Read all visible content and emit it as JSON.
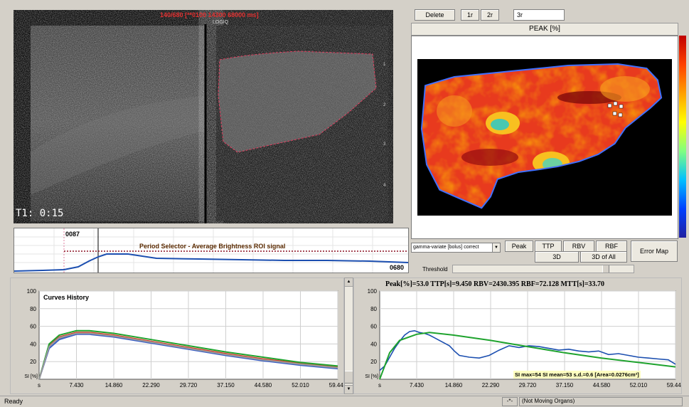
{
  "ultrasound": {
    "header_text": "140/680  [**0100 14300 68000 ms]",
    "logo_text": "LOGIQ",
    "timer": "T1: 0:15"
  },
  "toolbar": {
    "delete_label": "Delete",
    "tab_1": "1r",
    "tab_2": "2r",
    "tab_3": "3r"
  },
  "map": {
    "title": "PEAK [%]"
  },
  "period": {
    "label": "Period Selector - Average Brightness ROI signal",
    "start_frame": "0087",
    "end_frame": "0680"
  },
  "controls": {
    "model_select": "gamma-variate [bolus] correct",
    "peak": "Peak",
    "ttp": "TTP",
    "rbv": "RBV",
    "rbf": "RBF",
    "btn_3d": "3D",
    "btn_3d_all": "3D of All",
    "error_map": "Error Map",
    "threshold": "Threshold"
  },
  "history_chart": {
    "title": "Curves History",
    "ylabel": "SI [%]",
    "x_unit": "s",
    "yticks": [
      "100",
      "80",
      "60",
      "40",
      "20"
    ],
    "xticks": [
      "7.430",
      "14.860",
      "22.290",
      "29.720",
      "37.150",
      "44.580",
      "52.010",
      "59.440"
    ]
  },
  "fit_chart": {
    "header": "Peak[%]=53.0  TTP[s]=9.450  RBV=2430.395  RBF=72.128  MTT[s]=33.70",
    "stats": "SI max=54  SI mean=53   s.d.=0.6   [Area=0.0276cm²]",
    "ylabel": "SI [%]",
    "x_unit": "s",
    "yticks": [
      "100",
      "80",
      "60",
      "40",
      "20"
    ],
    "xticks": [
      "7.430",
      "14.860",
      "22.290",
      "29.720",
      "37.150",
      "44.580",
      "52.010",
      "59.440"
    ]
  },
  "status": {
    "ready": "Ready",
    "sep": "-*-",
    "mode": "(Not Moving Organs)"
  },
  "chart_data": [
    {
      "type": "line",
      "title": "Curves History",
      "xlabel": "s",
      "ylabel": "SI [%]",
      "ylim": [
        0,
        100
      ],
      "xlim": [
        0,
        59.44
      ],
      "grid": true,
      "x": [
        0,
        2,
        4,
        7.43,
        10,
        14.86,
        22.29,
        29.72,
        37.15,
        44.58,
        52.01,
        59.44
      ],
      "series": [
        {
          "color": "#d93a2b",
          "values": [
            0,
            38,
            48,
            53,
            53,
            50,
            43,
            36,
            29,
            23,
            18,
            14
          ]
        },
        {
          "color": "#f08a24",
          "values": [
            0,
            36,
            46,
            52,
            52,
            49,
            42,
            35,
            28,
            22,
            17,
            13
          ]
        },
        {
          "color": "#1fa32e",
          "values": [
            0,
            40,
            50,
            55,
            55,
            52,
            45,
            38,
            31,
            25,
            19,
            15
          ]
        },
        {
          "color": "#3a5fc8",
          "values": [
            0,
            35,
            45,
            51,
            51,
            48,
            41,
            34,
            27,
            21,
            16,
            12
          ]
        },
        {
          "color": "#9a9a9a",
          "values": [
            0,
            37,
            47,
            52,
            52,
            49,
            42,
            35,
            28,
            22,
            17,
            13
          ]
        }
      ]
    },
    {
      "type": "line",
      "title": "Peak[%]=53.0  TTP[s]=9.450  RBV=2430.395  RBF=72.128  MTT[s]=33.70",
      "xlabel": "s",
      "ylabel": "SI [%]",
      "ylim": [
        0,
        100
      ],
      "xlim": [
        0,
        59.44
      ],
      "grid": true,
      "fit": {
        "color": "#1fa32e",
        "x": [
          0,
          2,
          4,
          7.43,
          10,
          14.86,
          22.29,
          29.72,
          37.15,
          44.58,
          52.01,
          59.44
        ],
        "values": [
          0,
          30,
          44,
          51,
          53,
          50,
          44,
          37,
          30,
          24,
          19,
          14
        ]
      },
      "signal": {
        "color": "#1c4fb0",
        "x": [
          0,
          1,
          2,
          3,
          4,
          5,
          6,
          7,
          8,
          9,
          10,
          11,
          12,
          13,
          14,
          15,
          16,
          18,
          20,
          22,
          24,
          26,
          28,
          30,
          32,
          34,
          36,
          38,
          40,
          42,
          44,
          46,
          48,
          50,
          52,
          54,
          56,
          58,
          59.44
        ],
        "values": [
          10,
          15,
          25,
          35,
          43,
          50,
          54,
          55,
          53,
          52,
          50,
          47,
          44,
          41,
          38,
          32,
          27,
          25,
          24,
          27,
          33,
          38,
          36,
          38,
          37,
          35,
          33,
          34,
          32,
          31,
          32,
          28,
          29,
          27,
          25,
          24,
          23,
          22,
          17
        ]
      }
    }
  ]
}
